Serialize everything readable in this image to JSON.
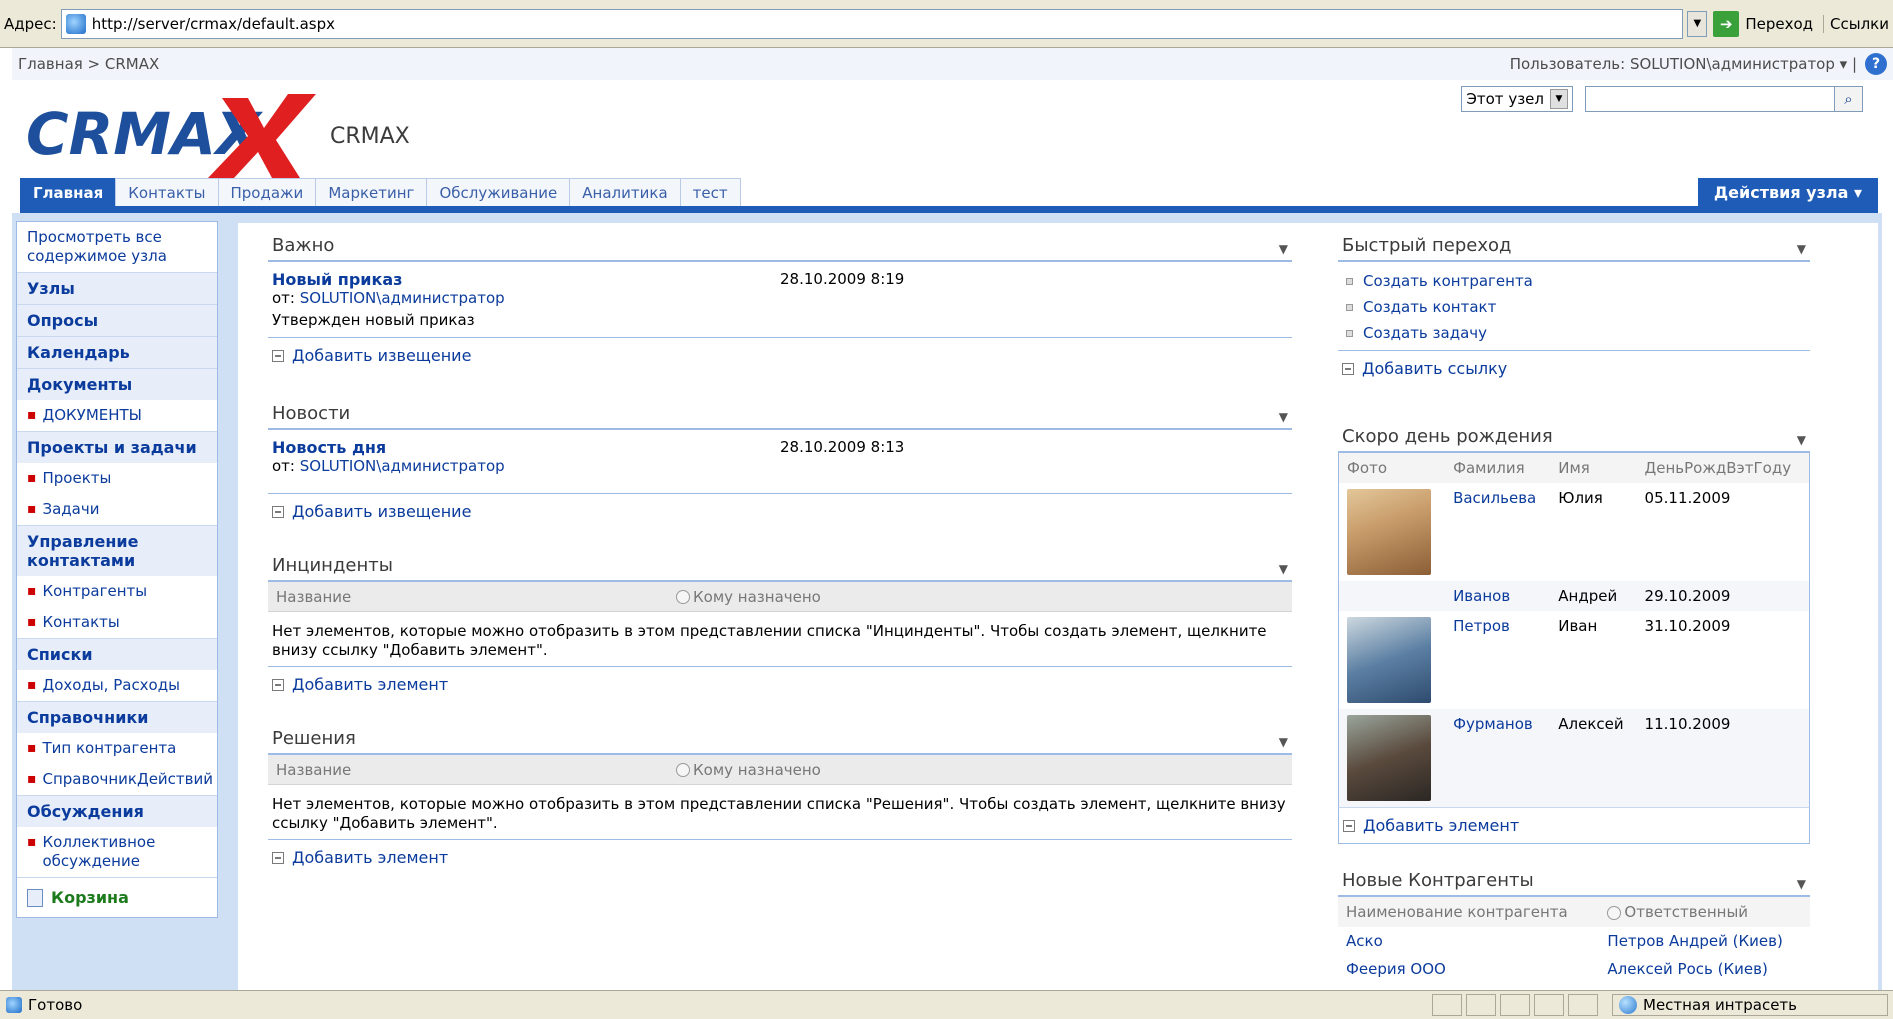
{
  "browser": {
    "address_label": "Адрес:",
    "url": "http://server/crmax/default.aspx",
    "go_label": "Переход",
    "links_label": "Ссылки",
    "status_text": "Готово",
    "zone_text": "Местная интрасеть"
  },
  "topbar": {
    "breadcrumb": "Главная > CRMAX",
    "user": "Пользователь: SOLUTION\\администратор ▾ |",
    "help_icon": "?"
  },
  "header": {
    "logo_text": "CRMAX",
    "site_title": "CRMAX",
    "search_scope": "Этот узел"
  },
  "tabs": [
    {
      "label": "Главная"
    },
    {
      "label": "Контакты"
    },
    {
      "label": "Продажи"
    },
    {
      "label": "Маркетинг"
    },
    {
      "label": "Обслуживание"
    },
    {
      "label": "Аналитика"
    },
    {
      "label": "тест"
    }
  ],
  "site_actions": "Действия узла ▾",
  "quicklaunch": {
    "view_all": "Просмотреть все содержимое узла",
    "sites": "Узлы",
    "surveys": "Опросы",
    "calendar": "Календарь",
    "documents": "Документы",
    "documents_items": [
      "ДОКУМЕНТЫ"
    ],
    "projects": "Проекты и задачи",
    "projects_items": [
      "Проекты",
      "Задачи"
    ],
    "contacts_mgmt": "Управление контактами",
    "contacts_items": [
      "Контрагенты",
      "Контакты"
    ],
    "lists": "Списки",
    "lists_items": [
      "Доходы, Расходы"
    ],
    "references": "Справочники",
    "references_items": [
      "Тип контрагента",
      "СправочникДействий"
    ],
    "discussions": "Обсуждения",
    "discussions_items": [
      "Коллективное обсуждение"
    ],
    "recycle": "Корзина"
  },
  "important": {
    "title": "Важно",
    "item_title": "Новый приказ",
    "item_date": "28.10.2009 8:19",
    "from_label": "от:",
    "from_user": "SOLUTION\\администратор",
    "item_body": "Утвержден новый приказ",
    "add_label": "Добавить извещение"
  },
  "news": {
    "title": "Новости",
    "item_title": "Новость дня",
    "item_date": "28.10.2009 8:13",
    "from_label": "от:",
    "from_user": "SOLUTION\\администратор",
    "add_label": "Добавить извещение"
  },
  "incidents": {
    "title": "Инцинденты",
    "col_name": "Название",
    "col_assigned": "Кому назначено",
    "empty": "Нет элементов, которые можно отобразить в этом представлении списка \"Инцинденты\". Чтобы создать элемент, щелкните внизу ссылку \"Добавить элемент\".",
    "add_label": "Добавить элемент"
  },
  "decisions": {
    "title": "Решения",
    "col_name": "Название",
    "col_assigned": "Кому назначено",
    "empty": "Нет элементов, которые можно отобразить в этом представлении списка \"Решения\". Чтобы создать элемент, щелкните внизу ссылку \"Добавить элемент\".",
    "add_label": "Добавить элемент"
  },
  "quicknav": {
    "title": "Быстрый переход",
    "items": [
      "Создать контрагента",
      "Создать контакт",
      "Создать задачу"
    ],
    "add_label": "Добавить ссылку"
  },
  "birthdays": {
    "title": "Скоро день рождения",
    "headers": [
      "Фото",
      "Фамилия",
      "Имя",
      "ДеньРождВэтГоду"
    ],
    "rows": [
      {
        "last": "Васильева",
        "first": "Юлия",
        "date": "05.11.2009"
      },
      {
        "last": "Иванов",
        "first": "Андрей",
        "date": "29.10.2009"
      },
      {
        "last": "Петров",
        "first": "Иван",
        "date": "31.10.2009"
      },
      {
        "last": "Фурманов",
        "first": "Алексей",
        "date": "11.10.2009"
      }
    ],
    "add_label": "Добавить элемент"
  },
  "new_partners": {
    "title": "Новые Контрагенты",
    "col_name": "Наименование контрагента",
    "col_resp": "Ответственный",
    "rows": [
      {
        "name": "Аско",
        "resp": "Петров Андрей (Киев)"
      },
      {
        "name": "Феерия ООО",
        "resp": "Алексей Рось (Киев)"
      }
    ]
  }
}
